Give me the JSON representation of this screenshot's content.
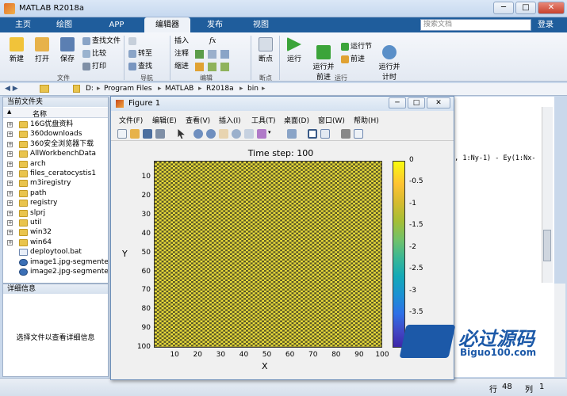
{
  "app": {
    "title": "MATLAB R2018a"
  },
  "window_controls": {
    "minimize": "─",
    "maximize": "□",
    "close": "✕"
  },
  "tabs": [
    {
      "label": "主页"
    },
    {
      "label": "绘图"
    },
    {
      "label": "APP"
    },
    {
      "label": "编辑器"
    },
    {
      "label": "发布"
    },
    {
      "label": "视图"
    }
  ],
  "search": {
    "placeholder": "搜索文档"
  },
  "login": "登录",
  "ribbon": {
    "file": {
      "new": "新建",
      "open": "打开",
      "save": "保存",
      "find_files": "查找文件",
      "compare": "比较",
      "print": "打印",
      "group": "文件"
    },
    "navigate": {
      "goto": "转至",
      "find": "查找",
      "group": "导航"
    },
    "edit": {
      "insert": "插入",
      "fx": "fx",
      "comment": "注释",
      "indent": "缩进",
      "group": "编辑"
    },
    "breakpoints": {
      "label": "断点",
      "group": "断点"
    },
    "run": {
      "run": "运行",
      "run_advance": "运行并\n前进",
      "run_section": "运行节",
      "advance": "前进",
      "run_time": "运行并\n计时",
      "group": "运行"
    }
  },
  "address": {
    "parts": [
      "D:",
      "Program Files",
      "MATLAB",
      "R2018a",
      "bin"
    ],
    "sep": "▸"
  },
  "current_folder": {
    "title": "当前文件夹",
    "col_name": "名称",
    "col_sort": "▲",
    "items": [
      {
        "name": "16G优盘资料",
        "type": "folder"
      },
      {
        "name": "360downloads",
        "type": "folder"
      },
      {
        "name": "360安全浏览器下载",
        "type": "folder"
      },
      {
        "name": "AllWorkbenchData",
        "type": "folder"
      },
      {
        "name": "arch",
        "type": "folder"
      },
      {
        "name": "files_ceratocystis1",
        "type": "folder"
      },
      {
        "name": "m3iregistry",
        "type": "folder"
      },
      {
        "name": "path",
        "type": "folder"
      },
      {
        "name": "registry",
        "type": "folder"
      },
      {
        "name": "slprj",
        "type": "folder"
      },
      {
        "name": "util",
        "type": "folder"
      },
      {
        "name": "win32",
        "type": "folder"
      },
      {
        "name": "win64",
        "type": "folder"
      },
      {
        "name": "deploytool.bat",
        "type": "file"
      },
      {
        "name": "image1.jpg-segmente...",
        "type": "img"
      },
      {
        "name": "image2.jpg-segmente...",
        "type": "img"
      }
    ]
  },
  "details": {
    "title": "详细信息",
    "text": "选择文件以查看详细信息"
  },
  "editor": {
    "code": "x, 1:Ny-1) - Ey(1:Nx-"
  },
  "status": {
    "row_label": "行",
    "row": "48",
    "col_label": "列",
    "col": "1"
  },
  "figure": {
    "title": "Figure 1",
    "menu": [
      "文件(F)",
      "编辑(E)",
      "查看(V)",
      "插入(I)",
      "工具(T)",
      "桌面(D)",
      "窗口(W)",
      "帮助(H)"
    ]
  },
  "chart_data": {
    "type": "heatmap",
    "title": "Time step: 100",
    "xlabel": "X",
    "ylabel": "Y",
    "xlim": [
      1,
      100
    ],
    "ylim": [
      1,
      100
    ],
    "x_ticks": [
      "10",
      "20",
      "30",
      "40",
      "50",
      "60",
      "70",
      "80",
      "90",
      "100"
    ],
    "y_ticks": [
      "10",
      "20",
      "30",
      "40",
      "50",
      "60",
      "70",
      "80",
      "90",
      "100"
    ],
    "pattern": "checkerboard",
    "dominant_values": [
      0,
      -0.1
    ],
    "colormap": "parula",
    "colorbar": {
      "ticks": [
        "0",
        "-0.5",
        "-1",
        "-1.5",
        "-2",
        "-2.5",
        "-3",
        "-3.5",
        "-4"
      ],
      "range": [
        -4.3,
        0
      ]
    },
    "colors": {
      "high": "#f9fb0e",
      "low": "#3e26a8",
      "cell_light": "#f2e33a",
      "cell_dark": "#5a5826"
    }
  },
  "watermark": {
    "main": "必过源码",
    "sub": "Biguo100.com"
  }
}
